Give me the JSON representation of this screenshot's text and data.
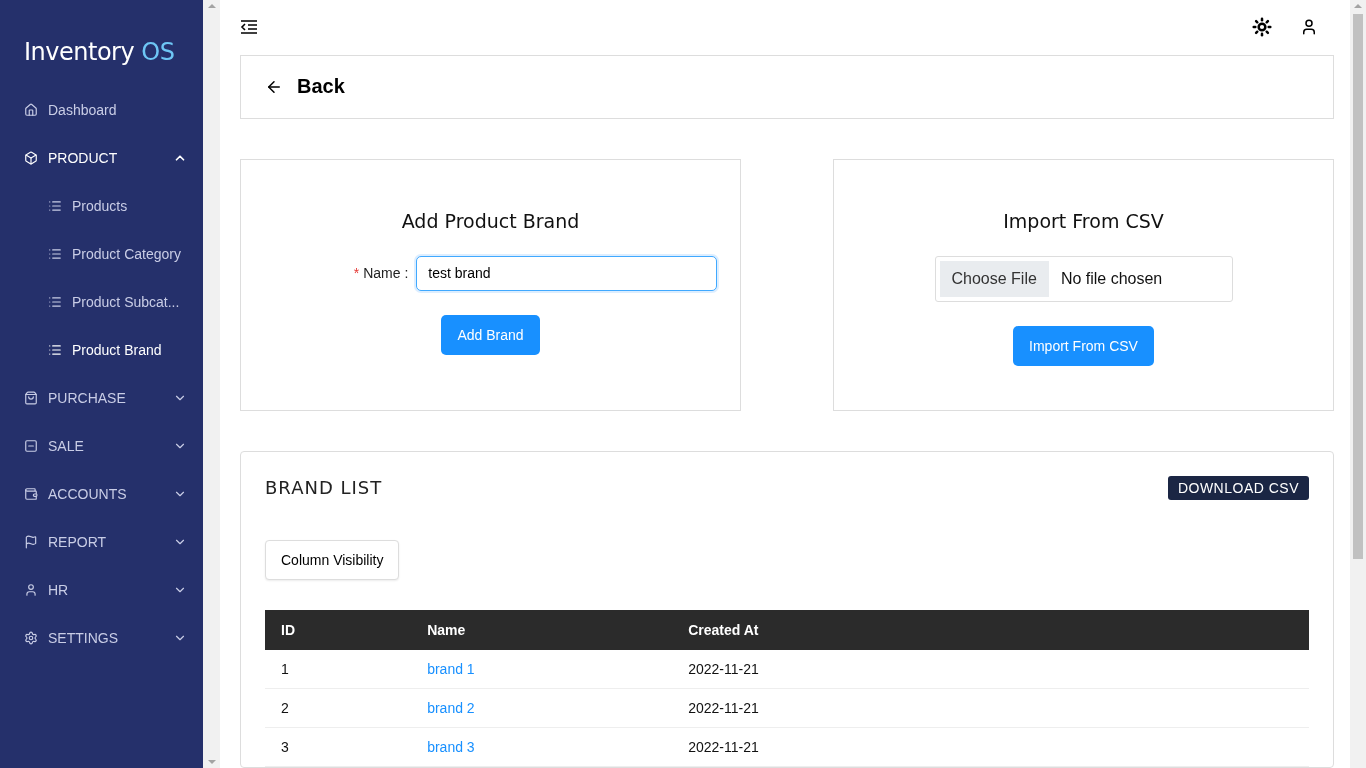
{
  "brand": {
    "name": "Inventory",
    "suffix": "OS"
  },
  "sidebar": {
    "items": [
      {
        "label": "Dashboard",
        "kind": "link",
        "selected": false
      },
      {
        "label": "PRODUCT",
        "kind": "group",
        "expanded": true,
        "children": [
          {
            "label": "Products",
            "selected": false
          },
          {
            "label": "Product Category",
            "selected": false
          },
          {
            "label": "Product Subcat...",
            "selected": false
          },
          {
            "label": "Product Brand",
            "selected": true
          }
        ]
      },
      {
        "label": "PURCHASE",
        "kind": "group",
        "expanded": false
      },
      {
        "label": "SALE",
        "kind": "group",
        "expanded": false
      },
      {
        "label": "ACCOUNTS",
        "kind": "group",
        "expanded": false
      },
      {
        "label": "REPORT",
        "kind": "group",
        "expanded": false
      },
      {
        "label": "HR",
        "kind": "group",
        "expanded": false
      },
      {
        "label": "SETTINGS",
        "kind": "group",
        "expanded": false
      }
    ]
  },
  "page_header": {
    "back_label": "Back"
  },
  "add_form": {
    "title": "Add Product Brand",
    "required_mark": "*",
    "field_label": "Name",
    "separator": ":",
    "value": "test brand",
    "submit": "Add Brand"
  },
  "import_form": {
    "title": "Import From CSV",
    "choose_button": "Choose File",
    "file_status": "No file chosen",
    "submit": "Import From CSV"
  },
  "brand_list": {
    "title": "BRAND LIST",
    "download": "DOWNLOAD CSV",
    "column_visibility": "Column Visibility",
    "columns": [
      "ID",
      "Name",
      "Created At"
    ],
    "rows": [
      {
        "id": "1",
        "name": "brand 1",
        "created_at": "2022-11-21"
      },
      {
        "id": "2",
        "name": "brand 2",
        "created_at": "2022-11-21"
      },
      {
        "id": "3",
        "name": "brand 3",
        "created_at": "2022-11-21"
      }
    ]
  }
}
